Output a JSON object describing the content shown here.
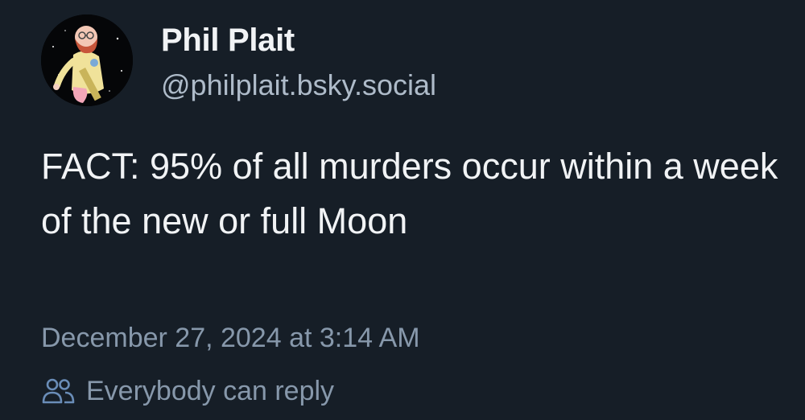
{
  "author": {
    "display_name": "Phil Plait",
    "handle": "@philplait.bsky.social",
    "avatar_icon": "cartoon-astronomer-avatar"
  },
  "post": {
    "text": "FACT: 95% of all murders occur within a week of the new or full Moon",
    "timestamp": "December 27, 2024 at 3:14 AM"
  },
  "reply_setting": {
    "icon": "people-icon",
    "label": "Everybody can reply"
  },
  "colors": {
    "background": "#161e27",
    "primary_text": "#f1f3f5",
    "secondary_text": "#8798ab",
    "accent": "#6a8db8"
  }
}
